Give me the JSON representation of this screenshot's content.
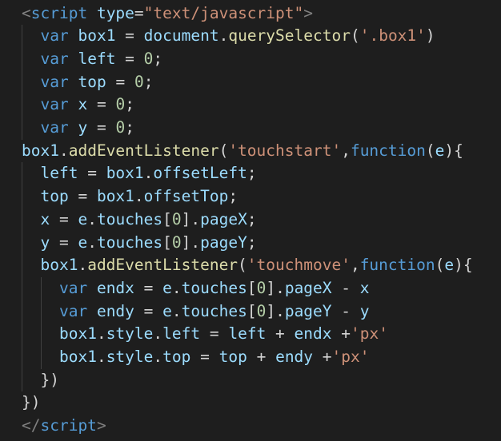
{
  "theme": {
    "background": "#1e1e1e",
    "indent_guide": "#404040",
    "colors": {
      "tag": "#808080",
      "tagname": "#569cd6",
      "attr": "#9cdcfe",
      "string": "#ce9178",
      "keyword": "#569cd6",
      "variable": "#9cdcfe",
      "func": "#dcdcaa",
      "number": "#b5cea8",
      "plain": "#d4d4d4"
    }
  },
  "code": {
    "lines": [
      [
        [
          "tag",
          "<"
        ],
        [
          "tagname",
          "script"
        ],
        [
          "plain",
          " "
        ],
        [
          "attr",
          "type"
        ],
        [
          "plain",
          "="
        ],
        [
          "string",
          "\"text/javascript\""
        ],
        [
          "tag",
          ">"
        ]
      ],
      [
        [
          "plain",
          "  "
        ],
        [
          "keyword",
          "var"
        ],
        [
          "plain",
          " "
        ],
        [
          "variable",
          "box1"
        ],
        [
          "plain",
          " = "
        ],
        [
          "variable",
          "document"
        ],
        [
          "plain",
          "."
        ],
        [
          "func",
          "querySelector"
        ],
        [
          "plain",
          "("
        ],
        [
          "string",
          "'.box1'"
        ],
        [
          "plain",
          ")"
        ]
      ],
      [
        [
          "plain",
          "  "
        ],
        [
          "keyword",
          "var"
        ],
        [
          "plain",
          " "
        ],
        [
          "variable",
          "left"
        ],
        [
          "plain",
          " = "
        ],
        [
          "number",
          "0"
        ],
        [
          "plain",
          ";"
        ]
      ],
      [
        [
          "plain",
          "  "
        ],
        [
          "keyword",
          "var"
        ],
        [
          "plain",
          " "
        ],
        [
          "variable",
          "top"
        ],
        [
          "plain",
          " = "
        ],
        [
          "number",
          "0"
        ],
        [
          "plain",
          ";"
        ]
      ],
      [
        [
          "plain",
          "  "
        ],
        [
          "keyword",
          "var"
        ],
        [
          "plain",
          " "
        ],
        [
          "variable",
          "x"
        ],
        [
          "plain",
          " = "
        ],
        [
          "number",
          "0"
        ],
        [
          "plain",
          ";"
        ]
      ],
      [
        [
          "plain",
          "  "
        ],
        [
          "keyword",
          "var"
        ],
        [
          "plain",
          " "
        ],
        [
          "variable",
          "y"
        ],
        [
          "plain",
          " = "
        ],
        [
          "number",
          "0"
        ],
        [
          "plain",
          ";"
        ]
      ],
      [
        [
          "variable",
          "box1"
        ],
        [
          "plain",
          "."
        ],
        [
          "func",
          "addEventListener"
        ],
        [
          "plain",
          "("
        ],
        [
          "string",
          "'touchstart'"
        ],
        [
          "plain",
          ","
        ],
        [
          "keyword",
          "function"
        ],
        [
          "plain",
          "("
        ],
        [
          "variable",
          "e"
        ],
        [
          "plain",
          "){"
        ]
      ],
      [
        [
          "plain",
          "  "
        ],
        [
          "variable",
          "left"
        ],
        [
          "plain",
          " = "
        ],
        [
          "variable",
          "box1"
        ],
        [
          "plain",
          "."
        ],
        [
          "variable",
          "offsetLeft"
        ],
        [
          "plain",
          ";"
        ]
      ],
      [
        [
          "plain",
          "  "
        ],
        [
          "variable",
          "top"
        ],
        [
          "plain",
          " = "
        ],
        [
          "variable",
          "box1"
        ],
        [
          "plain",
          "."
        ],
        [
          "variable",
          "offsetTop"
        ],
        [
          "plain",
          ";"
        ]
      ],
      [
        [
          "plain",
          "  "
        ],
        [
          "variable",
          "x"
        ],
        [
          "plain",
          " = "
        ],
        [
          "variable",
          "e"
        ],
        [
          "plain",
          "."
        ],
        [
          "variable",
          "touches"
        ],
        [
          "plain",
          "["
        ],
        [
          "number",
          "0"
        ],
        [
          "plain",
          "]."
        ],
        [
          "variable",
          "pageX"
        ],
        [
          "plain",
          ";"
        ]
      ],
      [
        [
          "plain",
          "  "
        ],
        [
          "variable",
          "y"
        ],
        [
          "plain",
          " = "
        ],
        [
          "variable",
          "e"
        ],
        [
          "plain",
          "."
        ],
        [
          "variable",
          "touches"
        ],
        [
          "plain",
          "["
        ],
        [
          "number",
          "0"
        ],
        [
          "plain",
          "]."
        ],
        [
          "variable",
          "pageY"
        ],
        [
          "plain",
          ";"
        ]
      ],
      [
        [
          "plain",
          "  "
        ],
        [
          "variable",
          "box1"
        ],
        [
          "plain",
          "."
        ],
        [
          "func",
          "addEventListener"
        ],
        [
          "plain",
          "("
        ],
        [
          "string",
          "'touchmove'"
        ],
        [
          "plain",
          ","
        ],
        [
          "keyword",
          "function"
        ],
        [
          "plain",
          "("
        ],
        [
          "variable",
          "e"
        ],
        [
          "plain",
          "){"
        ]
      ],
      [
        [
          "plain",
          "    "
        ],
        [
          "keyword",
          "var"
        ],
        [
          "plain",
          " "
        ],
        [
          "variable",
          "endx"
        ],
        [
          "plain",
          " = "
        ],
        [
          "variable",
          "e"
        ],
        [
          "plain",
          "."
        ],
        [
          "variable",
          "touches"
        ],
        [
          "plain",
          "["
        ],
        [
          "number",
          "0"
        ],
        [
          "plain",
          "]."
        ],
        [
          "variable",
          "pageX"
        ],
        [
          "plain",
          " - "
        ],
        [
          "variable",
          "x"
        ]
      ],
      [
        [
          "plain",
          "    "
        ],
        [
          "keyword",
          "var"
        ],
        [
          "plain",
          " "
        ],
        [
          "variable",
          "endy"
        ],
        [
          "plain",
          " = "
        ],
        [
          "variable",
          "e"
        ],
        [
          "plain",
          "."
        ],
        [
          "variable",
          "touches"
        ],
        [
          "plain",
          "["
        ],
        [
          "number",
          "0"
        ],
        [
          "plain",
          "]."
        ],
        [
          "variable",
          "pageY"
        ],
        [
          "plain",
          " - "
        ],
        [
          "variable",
          "y"
        ]
      ],
      [
        [
          "plain",
          "    "
        ],
        [
          "variable",
          "box1"
        ],
        [
          "plain",
          "."
        ],
        [
          "variable",
          "style"
        ],
        [
          "plain",
          "."
        ],
        [
          "variable",
          "left"
        ],
        [
          "plain",
          " = "
        ],
        [
          "variable",
          "left"
        ],
        [
          "plain",
          " + "
        ],
        [
          "variable",
          "endx"
        ],
        [
          "plain",
          " +"
        ],
        [
          "string",
          "'px'"
        ]
      ],
      [
        [
          "plain",
          "    "
        ],
        [
          "variable",
          "box1"
        ],
        [
          "plain",
          "."
        ],
        [
          "variable",
          "style"
        ],
        [
          "plain",
          "."
        ],
        [
          "variable",
          "top"
        ],
        [
          "plain",
          " = "
        ],
        [
          "variable",
          "top"
        ],
        [
          "plain",
          " + "
        ],
        [
          "variable",
          "endy"
        ],
        [
          "plain",
          " +"
        ],
        [
          "string",
          "'px'"
        ]
      ],
      [
        [
          "plain",
          "  })"
        ]
      ],
      [
        [
          "plain",
          "})"
        ]
      ],
      [
        [
          "tag",
          "</"
        ],
        [
          "tagname",
          "script"
        ],
        [
          "tag",
          ">"
        ]
      ]
    ]
  }
}
